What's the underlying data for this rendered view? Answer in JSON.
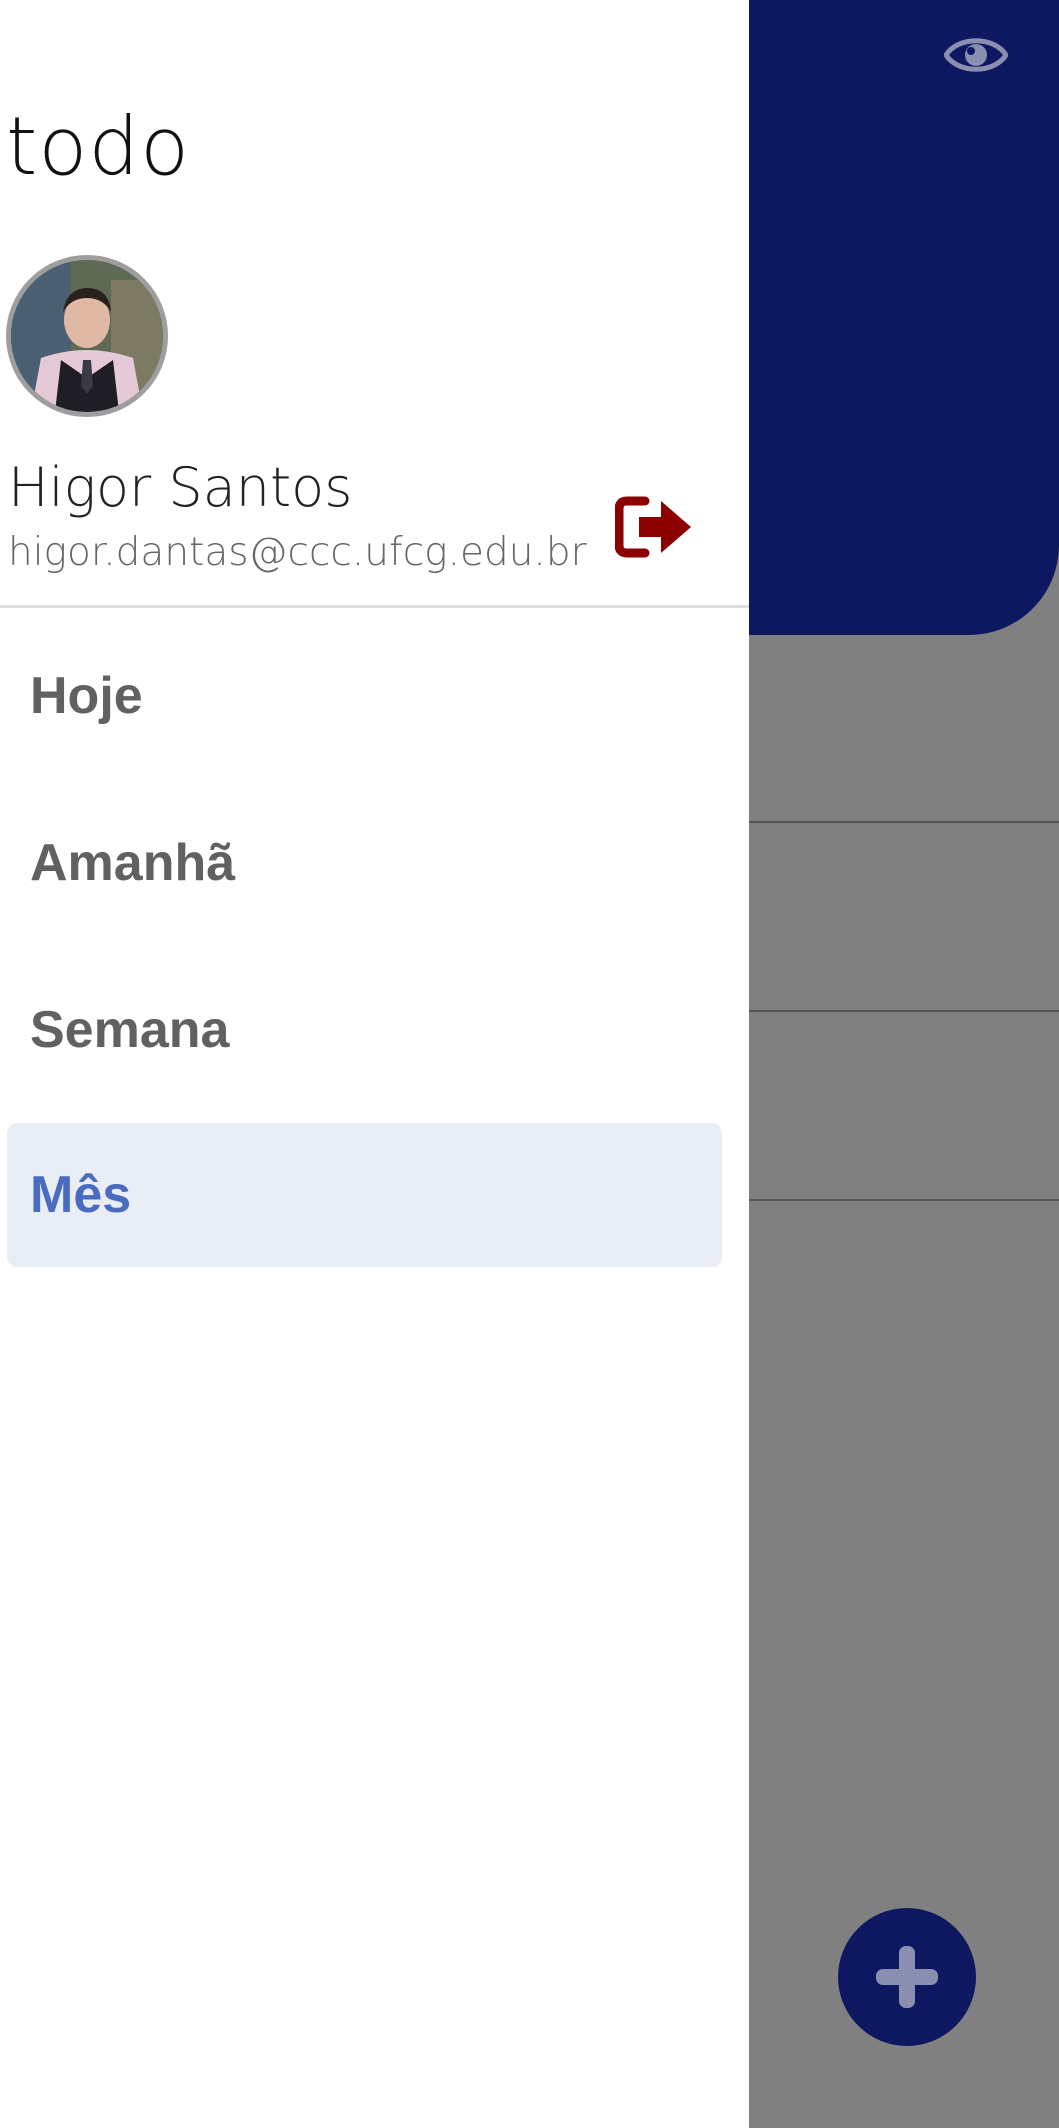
{
  "app": {
    "title": "todo"
  },
  "user": {
    "name": "Higor Santos",
    "email": "higor.dantas@ccc.ufcg.edu.br"
  },
  "menu": {
    "items": [
      {
        "label": "Hoje",
        "active": false
      },
      {
        "label": "Amanhã",
        "active": false
      },
      {
        "label": "Semana",
        "active": false
      },
      {
        "label": "Mês",
        "active": true
      }
    ]
  },
  "icons": {
    "visibility": "eye-icon",
    "logout": "sign-out-icon",
    "add": "plus-icon"
  },
  "colors": {
    "primary": "#0d1860",
    "logout": "#8b0000",
    "active_item_bg": "#e9edf6",
    "active_item_text": "#4a6cc0",
    "overlay": "#808080"
  }
}
